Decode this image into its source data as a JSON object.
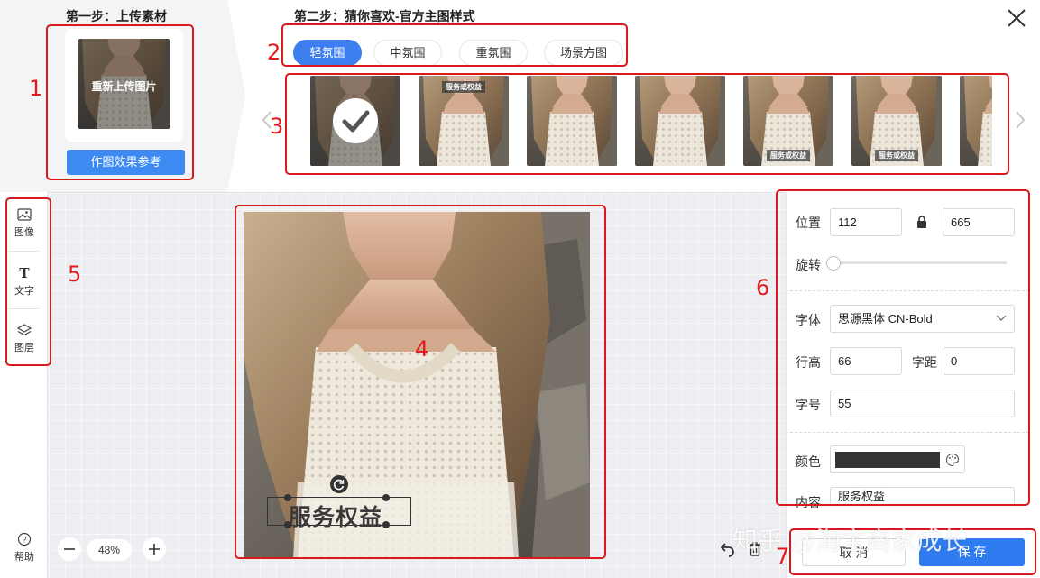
{
  "step1": {
    "title": "第一步：上传素材",
    "reupload_label": "重新上传图片",
    "reference_button": "作图效果参考"
  },
  "step2": {
    "title": "第二步：猜你喜欢-官方主图样式",
    "tabs": [
      {
        "label": "轻氛围",
        "active": true
      },
      {
        "label": "中氛围",
        "active": false
      },
      {
        "label": "重氛围",
        "active": false
      },
      {
        "label": "场景方图",
        "active": false
      }
    ],
    "template_tags": [
      "",
      "服务或权益",
      "",
      "",
      "服务或权益",
      "服务或权益",
      ""
    ]
  },
  "toolbar": {
    "items": [
      {
        "label": "图像",
        "icon": "image-icon"
      },
      {
        "label": "文字",
        "icon": "text-icon"
      },
      {
        "label": "图层",
        "icon": "layers-icon"
      }
    ],
    "help_label": "帮助"
  },
  "canvas": {
    "overlay_text": "服务权益",
    "zoom": "48%"
  },
  "properties": {
    "position_label": "位置",
    "x": "112",
    "y": "665",
    "rotate_label": "旋转",
    "rotation_percent": 0,
    "font_label": "字体",
    "font_value": "思源黑体 CN-Bold",
    "line_height_label": "行高",
    "line_height": "66",
    "letter_spacing_label": "字距",
    "letter_spacing": "0",
    "font_size_label": "字号",
    "font_size": "55",
    "color_label": "颜色",
    "color_value": "#333333",
    "content_label": "内容",
    "content_value": "服务权益"
  },
  "footer": {
    "cancel": "取 消",
    "save": "保 存"
  },
  "annotations": [
    "1",
    "2",
    "3",
    "4",
    "5",
    "6",
    "7"
  ],
  "watermark": "知乎 @淘宝商家成长",
  "colors": {
    "accent": "#3d7ff0",
    "annotation": "#d9191c"
  }
}
